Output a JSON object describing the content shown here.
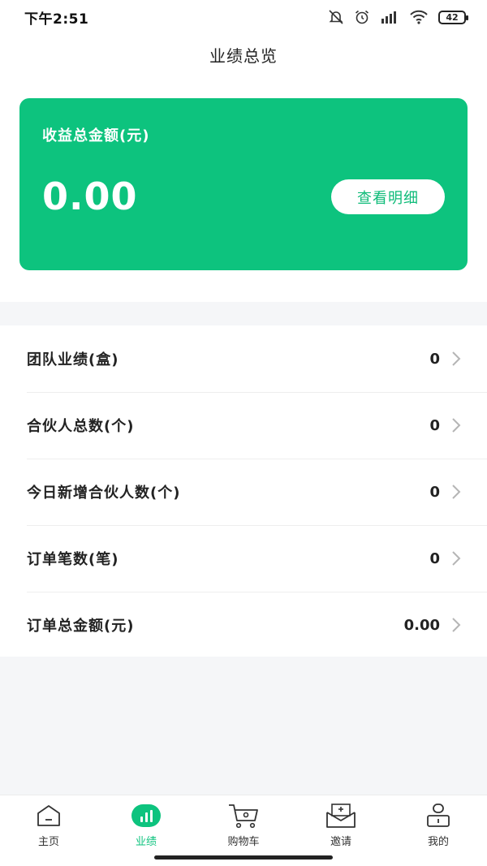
{
  "status_bar": {
    "time": "下午2:51",
    "battery": "42",
    "icons": [
      "mute-icon",
      "alarm-icon",
      "signal-icon",
      "wifi-icon",
      "battery-icon"
    ]
  },
  "header": {
    "title": "业绩总览"
  },
  "earnings_card": {
    "label": "收益总金额(元)",
    "amount": "0.00",
    "detail_button": "查看明细",
    "color": "#0dc37e"
  },
  "stats": [
    {
      "label": "团队业绩(盒)",
      "value": "0"
    },
    {
      "label": "合伙人总数(个)",
      "value": "0"
    },
    {
      "label": "今日新增合伙人数(个)",
      "value": "0"
    },
    {
      "label": "订单笔数(笔)",
      "value": "0"
    },
    {
      "label": "订单总金额(元)",
      "value": "0.00"
    }
  ],
  "bottom_nav": {
    "active_color": "#0dc37e",
    "items": [
      {
        "label": "主页",
        "icon": "home-icon",
        "active": false
      },
      {
        "label": "业绩",
        "icon": "chart-icon",
        "active": true
      },
      {
        "label": "购物车",
        "icon": "cart-icon",
        "active": false
      },
      {
        "label": "邀请",
        "icon": "invite-icon",
        "active": false
      },
      {
        "label": "我的",
        "icon": "profile-icon",
        "active": false
      }
    ]
  }
}
